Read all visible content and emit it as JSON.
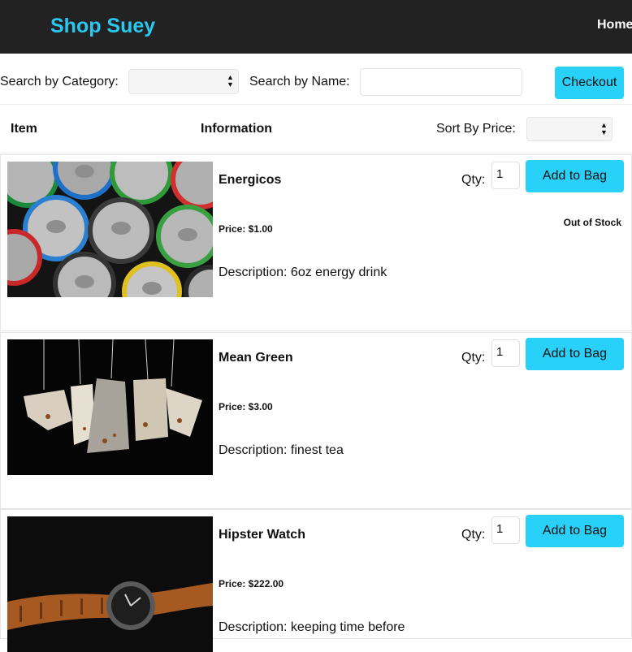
{
  "navbar": {
    "brand": "Shop Suey",
    "home_link": "Home"
  },
  "search": {
    "category_label": "Search by Category:",
    "category_value": "",
    "name_label": "Search by Name:",
    "name_value": "",
    "checkout_label": "Checkout"
  },
  "table_header": {
    "item": "Item",
    "information": "Information",
    "sort_label": "Sort By Price:",
    "sort_value": ""
  },
  "products": [
    {
      "name": "Energicos",
      "price": "Price: $1.00",
      "description": "Description: 6oz energy drink",
      "qty_label": "Qty:",
      "qty_value": "1",
      "add_label": "Add to Bag",
      "stock_status": "Out of Stock",
      "image": "energy-drink-cans-photo"
    },
    {
      "name": "Mean Green",
      "price": "Price: $3.00",
      "description": "Description: finest tea",
      "qty_label": "Qty:",
      "qty_value": "1",
      "add_label": "Add to Bag",
      "image": "tea-bags-photo"
    },
    {
      "name": "Hipster Watch",
      "price": "Price: $222.00",
      "description": "Description: keeping time before",
      "qty_label": "Qty:",
      "qty_value": "1",
      "add_label": "Add to Bag",
      "image": "wristwatch-photo"
    }
  ],
  "colors": {
    "navbar_bg": "#222222",
    "brand": "#29c8f0",
    "button": "#29d0f8"
  }
}
